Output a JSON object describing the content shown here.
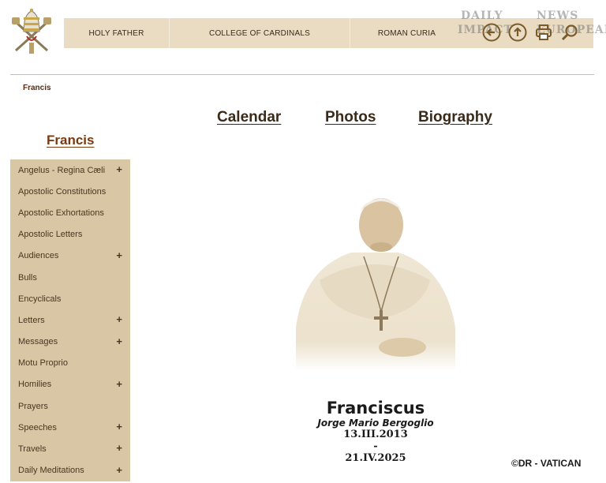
{
  "topnav": {
    "items": [
      "HOLY FATHER",
      "COLLEGE OF CARDINALS",
      "ROMAN CURIA"
    ]
  },
  "tools": {
    "icons": [
      "back-arrow-icon",
      "up-arrow-icon",
      "print-icon",
      "search-icon"
    ]
  },
  "watermark": {
    "line1a": "DAILY",
    "line1b": "NEWS",
    "line2a": "IMPACT",
    "line2b": "EUROPEAN"
  },
  "breadcrumb": "Francis",
  "tabs": [
    "Calendar",
    "Photos",
    "Biography"
  ],
  "sidebar": {
    "title": "Francis",
    "items": [
      {
        "label": "Angelus - Regina Cæli",
        "expand": "+"
      },
      {
        "label": "Apostolic Constitutions",
        "expand": ""
      },
      {
        "label": "Apostolic Exhortations",
        "expand": ""
      },
      {
        "label": "Apostolic Letters",
        "expand": ""
      },
      {
        "label": "Audiences",
        "expand": "+"
      },
      {
        "label": "Bulls",
        "expand": ""
      },
      {
        "label": "Encyclicals",
        "expand": ""
      },
      {
        "label": "Letters",
        "expand": "+"
      },
      {
        "label": "Messages",
        "expand": "+"
      },
      {
        "label": "Motu Proprio",
        "expand": ""
      },
      {
        "label": "Homilies",
        "expand": "+"
      },
      {
        "label": "Prayers",
        "expand": ""
      },
      {
        "label": "Speeches",
        "expand": "+"
      },
      {
        "label": "Travels",
        "expand": "+"
      },
      {
        "label": "Daily Meditations",
        "expand": "+"
      }
    ]
  },
  "caption": {
    "name": "Franciscus",
    "full_name": "Jorge Mario Bergoglio",
    "start_date": "13.III.2013",
    "separator": "-",
    "end_date": "21.IV.2025"
  },
  "credit": "©DR - VATICAN",
  "colors": {
    "nav_bg": "#e9dcc3",
    "sidebar_bg": "#d9c6a5",
    "link_brown": "#7a3a10"
  }
}
